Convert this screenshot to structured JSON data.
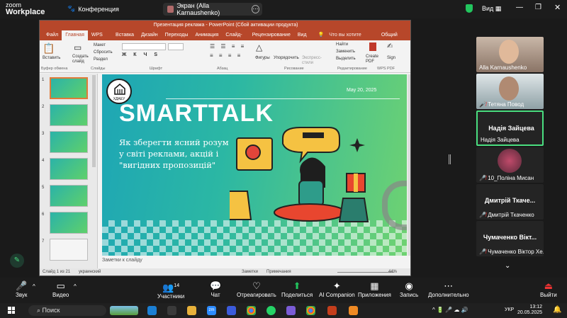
{
  "zoom_top": {
    "app_line1": "zoom",
    "app_line2": "Workplace",
    "conference": "Конференция",
    "share_label": "Экран (Alla Karnaushenko)",
    "view": "Вид"
  },
  "ppt": {
    "title": "Презентация реклама - PowerPoint (Сбой активации продукта)",
    "tabs": [
      "Файл",
      "Главная",
      "WPS PDF",
      "Вставка",
      "Дизайн",
      "Переходы",
      "Анимация",
      "Слайд-шоу",
      "Рецензирование",
      "Вид"
    ],
    "active_tab": "Главная",
    "tell_me": "Что вы хотите сделать?",
    "share": "Общий доступ",
    "ribbon": {
      "paste": "Вставить",
      "create_slide": "Создать слайд",
      "layout": "Макет",
      "reset": "Сбросить",
      "section": "Раздел",
      "shapes": "Фигуры",
      "arrange": "Упорядочить",
      "express": "Экспресс-стили",
      "find": "Найти",
      "replace": "Заменить",
      "select": "Выделить",
      "create_pdf": "Create PDF",
      "sign": "Sign",
      "groups": {
        "clipboard": "Буфер обмена",
        "slides": "Слайды",
        "font": "Шрифт",
        "paragraph": "Абзац",
        "drawing": "Рисование",
        "editing": "Редактирование",
        "wps": "WPS PDF"
      }
    },
    "slide_numbers": [
      "1",
      "2",
      "3",
      "4",
      "5",
      "6",
      "7"
    ],
    "slide": {
      "date": "May 20, 2025",
      "title": "SMARTTALK",
      "logo_text": "ХДАЕУ",
      "body": "Як зберегти ясний розум у світі реклами, акцій і \"вигідних пропозицій\""
    },
    "notes": "Заметки к слайду",
    "status": {
      "slide": "Слайд 1 из 21",
      "lang": "украинский",
      "notes_btn": "Заметки",
      "comments_btn": "Примечания",
      "zoom": "44%"
    }
  },
  "participants": [
    {
      "name": "Alla Karnaushenko",
      "big": "",
      "muted": false
    },
    {
      "name": "Тетяна Повод",
      "big": "",
      "muted": true
    },
    {
      "name": "Надія Зайцева",
      "big": "Надія Зайцева",
      "muted": false
    },
    {
      "name": "10_Поліна Мисан",
      "big": "",
      "muted": true
    },
    {
      "name": "Дмитрій Ткаченко",
      "big": "Дмитрій Ткаче...",
      "muted": true
    },
    {
      "name": "Чумаченко Віктор Хе...",
      "big": "Чумаченко Вікт...",
      "muted": true
    }
  ],
  "toolbar": {
    "audio": "Звук",
    "video": "Видео",
    "participants": "Участники",
    "participants_count": "14",
    "chat": "Чат",
    "react": "Отреагировать",
    "share": "Поделиться",
    "ai": "AI Companion",
    "apps": "Приложения",
    "record": "Запись",
    "more": "Дополнительно",
    "leave": "Выйти"
  },
  "taskbar": {
    "search": "Поиск",
    "lang": "УКР",
    "time": "13:12",
    "date": "20.05.2025"
  },
  "colors": {
    "ppt_accent": "#b7472a",
    "speaking_border": "#4ade80",
    "share_green": "#22c55e"
  }
}
